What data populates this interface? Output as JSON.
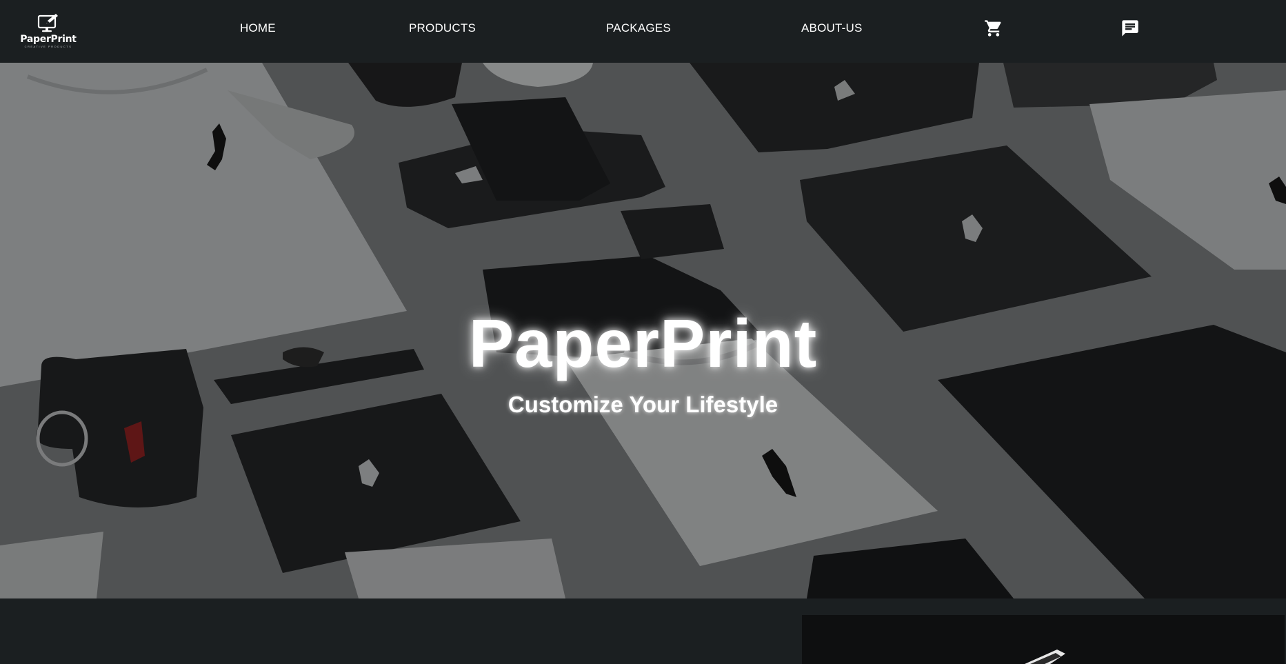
{
  "brand": {
    "logo_text": "PaperPrint",
    "logo_tagline": "CREATIVE PRODUCTS",
    "logo_icon": "monitor-edit-icon"
  },
  "nav": {
    "items": [
      {
        "label": "HOME"
      },
      {
        "label": "PRODUCTS"
      },
      {
        "label": "PACKAGES"
      },
      {
        "label": "ABOUT-US"
      }
    ],
    "cart_icon": "cart-icon",
    "chat_icon": "chat-icon"
  },
  "hero": {
    "title": "PaperPrint",
    "subtitle": "Customize Your Lifestyle",
    "background": "merchandise flat-lay photo"
  },
  "colors": {
    "header_bg": "#1b1f21",
    "hero_overlay": "#595b5c",
    "text": "#ffffff"
  }
}
